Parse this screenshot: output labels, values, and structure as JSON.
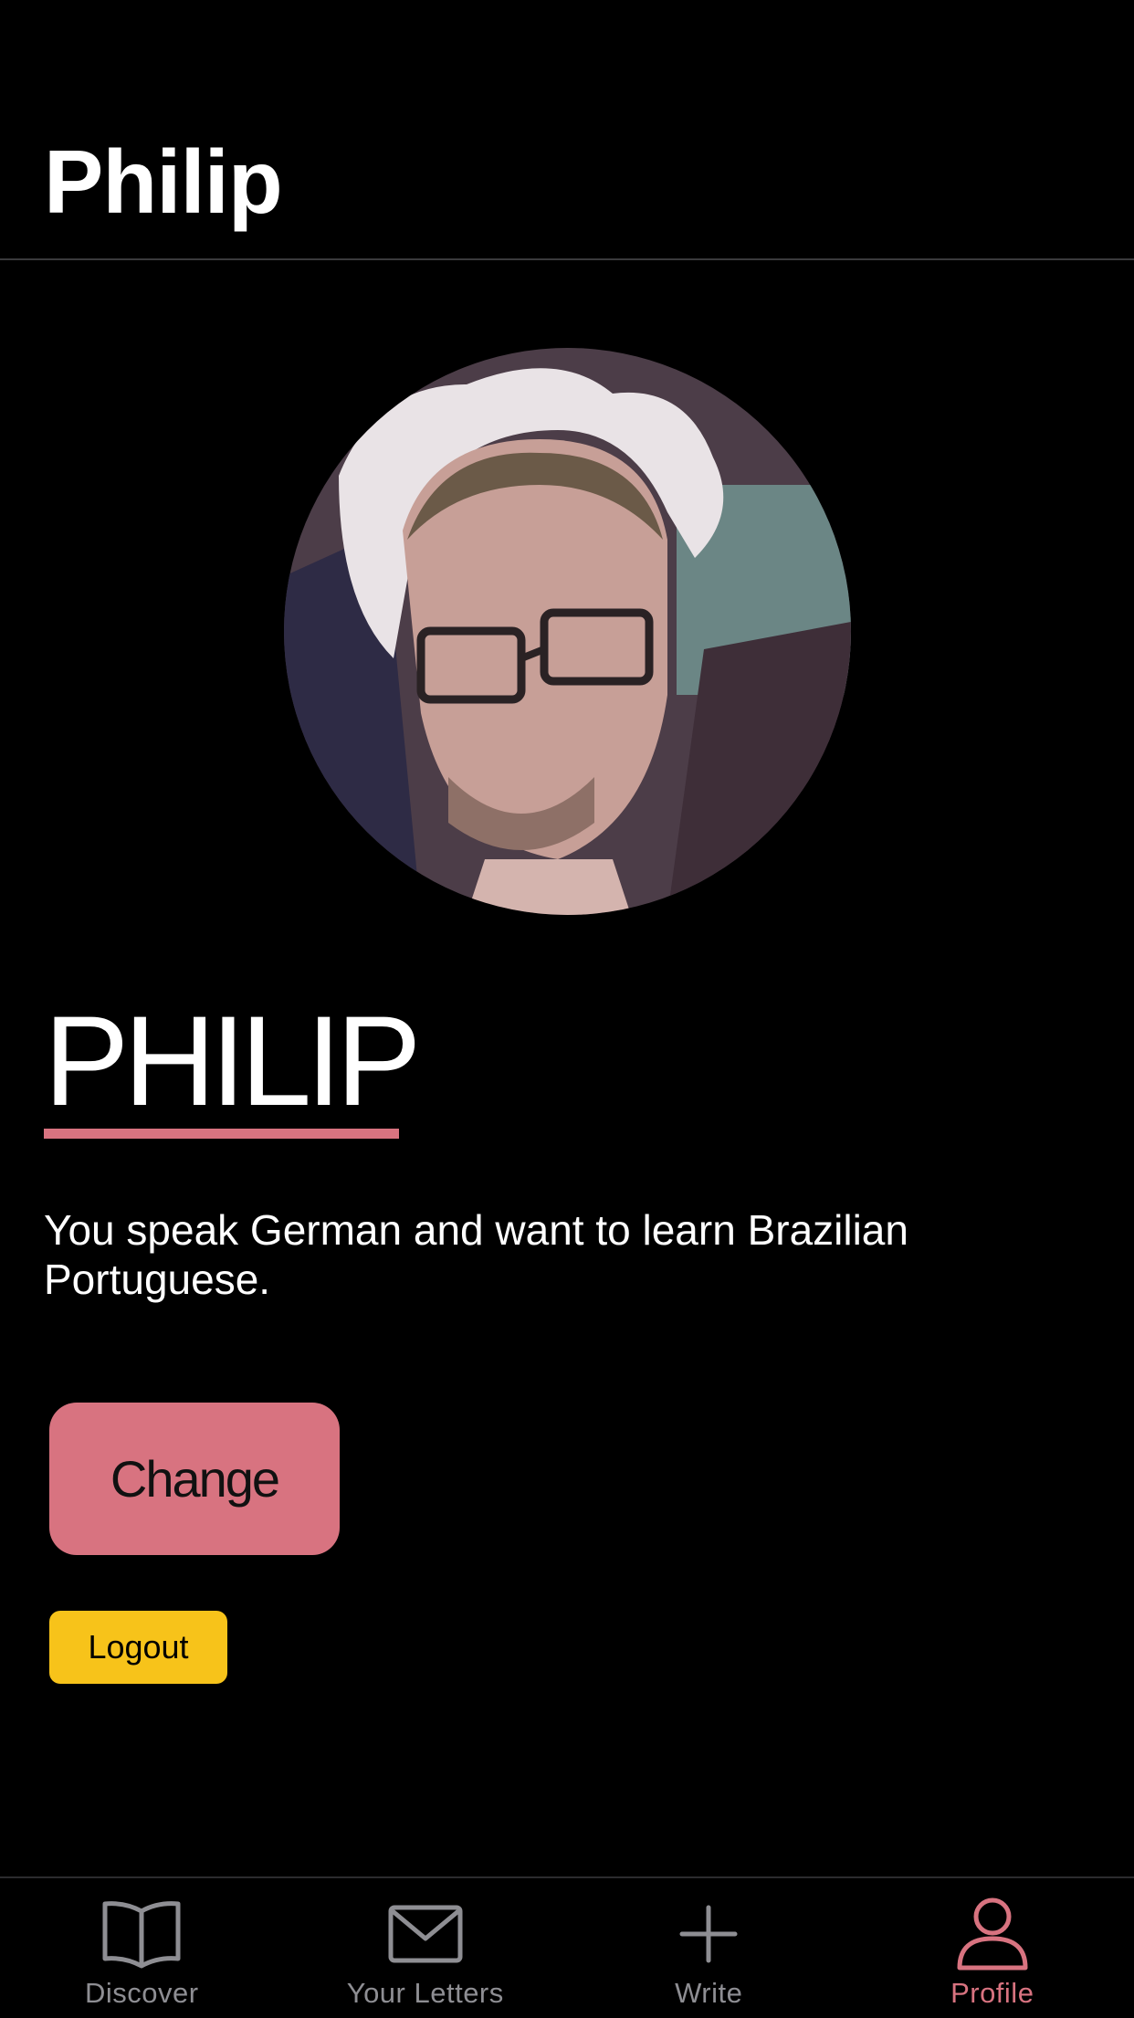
{
  "header": {
    "title": "Philip"
  },
  "profile": {
    "display_name": "PHILIP",
    "bio": "You speak German and want to learn Brazilian Portuguese.",
    "change_label": "Change",
    "logout_label": "Logout"
  },
  "tabs": [
    {
      "label": "Discover",
      "icon": "book-icon",
      "active": false
    },
    {
      "label": "Your Letters",
      "icon": "envelope-icon",
      "active": false
    },
    {
      "label": "Write",
      "icon": "plus-icon",
      "active": false
    },
    {
      "label": "Profile",
      "icon": "person-icon",
      "active": true
    }
  ],
  "colors": {
    "accent": "#d87380",
    "logout": "#f7c31a",
    "inactive": "#8e8e93"
  }
}
